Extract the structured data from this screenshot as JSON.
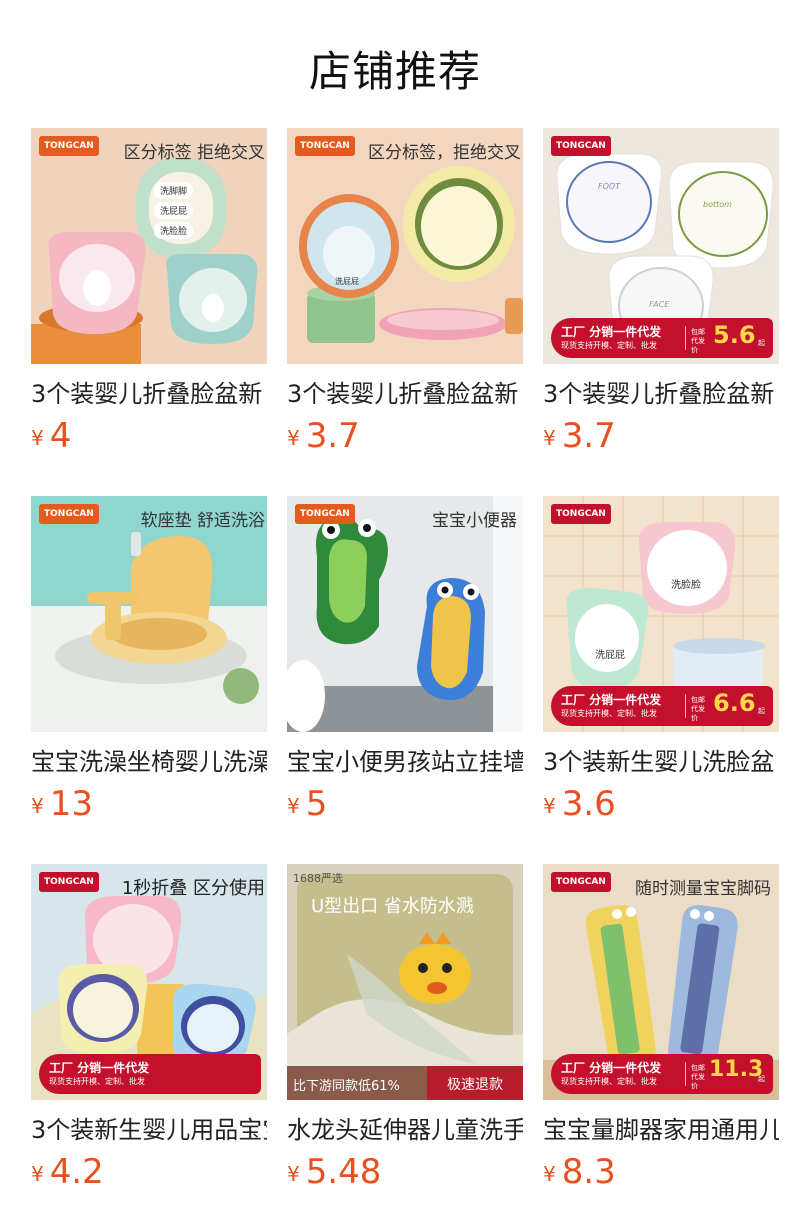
{
  "page_title": "店铺推荐",
  "colors": {
    "price": "#e8501e",
    "brand_badge": "#e35b1e",
    "promo_red": "#c2102d",
    "promo_yellow": "#ffd84a"
  },
  "currency_symbol": "¥",
  "products": [
    {
      "name": "3个装婴儿折叠脸盆新",
      "price": "4",
      "brand": "TONGCAN",
      "caption": "区分标签 拒绝交叉",
      "bg": "#e9c9b1",
      "labels": [
        "洗脚脚",
        "洗屁屁",
        "洗脸脸"
      ]
    },
    {
      "name": "3个装婴儿折叠脸盆新",
      "price": "3.7",
      "brand": "TONGCAN",
      "caption": "区分标签，拒绝交叉",
      "bg": "#f1d0b8",
      "labels": [
        "洗屁屁"
      ]
    },
    {
      "name": "3个装婴儿折叠脸盆新",
      "price": "3.7",
      "brand": "TONGCAN",
      "bg": "#ede6dd",
      "promo": {
        "line1": "工厂 分销一件代发",
        "line2": "现货支持开模、定制、批发",
        "prefix": "包邮 代发价",
        "price": "5.6",
        "suffix": "起"
      },
      "labels": [
        "FOOT",
        "bottom",
        "FACE"
      ]
    },
    {
      "name": "宝宝洗澡坐椅婴儿洗澡",
      "price": "13",
      "brand": "TONGCAN",
      "caption": "软座垫 舒适洗浴",
      "bg": "#cfe8e2"
    },
    {
      "name": "宝宝小便男孩站立挂墙",
      "price": "5",
      "brand": "TONGCAN",
      "caption": "宝宝小便器",
      "bg": "#e8ecee"
    },
    {
      "name": "3个装新生婴儿洗脸盆",
      "price": "3.6",
      "brand": "TONGCAN",
      "bg": "#f4e1c8",
      "promo": {
        "line1": "工厂 分销一件代发",
        "line2": "现货支持开模、定制、批发",
        "prefix": "包邮 代发价",
        "price": "6.6",
        "suffix": "起"
      },
      "labels": [
        "洗脸脸",
        "洗屁屁"
      ]
    },
    {
      "name": "3个装新生婴儿用品宝宝",
      "price": "4.2",
      "brand": "TONGCAN",
      "caption": "1秒折叠 区分使用",
      "bg": "#dbe9ef",
      "promo": {
        "line1": "工厂 分销一件代发",
        "line2": "现货支持开模、定制、批发",
        "prefix": "",
        "price": "",
        "suffix": ""
      }
    },
    {
      "name": "水龙头延伸器儿童洗手",
      "price": "5.48",
      "caption": "U型出口 省水防水溅",
      "tag": "1688严选",
      "bg": "#c7c2a4",
      "bottombar": {
        "left": "比下游同款低61%",
        "right": "极速退款"
      }
    },
    {
      "name": "宝宝量脚器家用通用儿",
      "price": "8.3",
      "brand": "TONGCAN",
      "caption": "随时测量宝宝脚码",
      "bg": "#e9d9c4",
      "promo": {
        "line1": "工厂 分销一件代发",
        "line2": "现货支持开模、定制、批发",
        "prefix": "包邮 代发价",
        "price": "11.3",
        "suffix": "起"
      }
    }
  ]
}
